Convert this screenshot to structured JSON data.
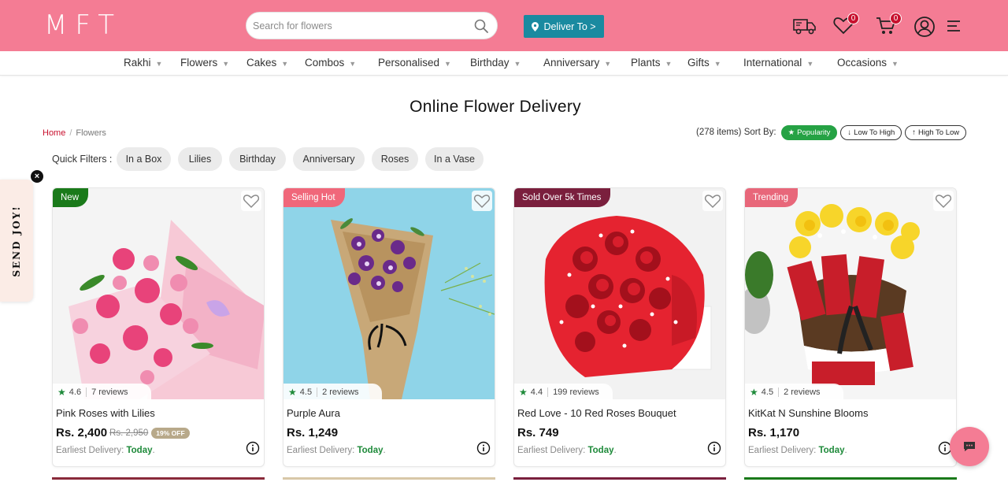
{
  "header": {
    "logo": "MFT",
    "search_placeholder": "Search for flowers",
    "deliver_label": "Deliver To >",
    "wishlist_count": "0",
    "cart_count": "0"
  },
  "nav": [
    "Rakhi",
    "Flowers",
    "Cakes",
    "Combos",
    "Personalised",
    "Birthday",
    "Anniversary",
    "Plants",
    "Gifts",
    "International",
    "Occasions"
  ],
  "page_title": "Online Flower Delivery",
  "breadcrumb": {
    "home": "Home",
    "sep": "/",
    "current": "Flowers"
  },
  "sort": {
    "count_label": "(278 items) Sort By:",
    "popularity": "Popularity",
    "low_to_high": "Low To High",
    "high_to_low": "High To Low"
  },
  "quick_filters": {
    "label": "Quick Filters :",
    "items": [
      "In a Box",
      "Lilies",
      "Birthday",
      "Anniversary",
      "Roses",
      "In a Vase"
    ]
  },
  "side_tab": {
    "label": "SEND JOY!",
    "close": "×"
  },
  "products": [
    {
      "tag": "New",
      "tag_color": "#1a7a1a",
      "rating": "4.6",
      "reviews": "7 reviews",
      "name": "Pink Roses with Lilies",
      "price": "Rs. 2,400",
      "mrp": "Rs. 2,950",
      "discount": "19% OFF",
      "delivery_label": "Earliest Delivery:",
      "delivery_day": "Today",
      "delivery_end": "."
    },
    {
      "tag": "Selling Hot",
      "tag_color": "#f0677a",
      "rating": "4.5",
      "reviews": "2 reviews",
      "name": "Purple Aura",
      "price": "Rs. 1,249",
      "mrp": "",
      "discount": "",
      "delivery_label": "Earliest Delivery:",
      "delivery_day": "Today",
      "delivery_end": "."
    },
    {
      "tag": "Sold Over 5k Times",
      "tag_color": "#7a1f3d",
      "rating": "4.4",
      "reviews": "199 reviews",
      "name": "Red Love - 10 Red Roses Bouquet",
      "price": "Rs. 749",
      "mrp": "",
      "discount": "",
      "delivery_label": "Earliest Delivery:",
      "delivery_day": "Today",
      "delivery_end": "."
    },
    {
      "tag": "Trending",
      "tag_color": "#e8677a",
      "rating": "4.5",
      "reviews": "2 reviews",
      "name": "KitKat N Sunshine Blooms",
      "price": "Rs. 1,170",
      "mrp": "",
      "discount": "",
      "delivery_label": "Earliest Delivery:",
      "delivery_day": "Today",
      "delivery_end": "."
    }
  ],
  "icons": [
    "search-icon",
    "location-pin-icon",
    "delivery-truck-icon",
    "heart-icon",
    "cart-icon",
    "user-icon",
    "menu-icon",
    "star-icon",
    "info-icon",
    "chat-icon"
  ],
  "colors": {
    "brand": "#f47c94",
    "deliver_button": "#1a8aa0",
    "sort_active": "#25a244",
    "badge": "#c8102e",
    "delivery_today": "#1e8a3a"
  }
}
